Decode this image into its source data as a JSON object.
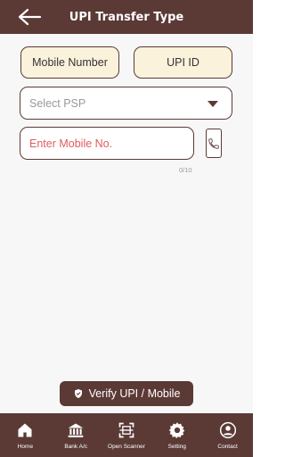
{
  "header": {
    "title": "UPI Transfer Type",
    "back_icon": "back-arrow-icon"
  },
  "transfer_type": {
    "mobile_label": "Mobile Number",
    "upi_label": "UPI ID"
  },
  "psp": {
    "placeholder": "Select PSP"
  },
  "mobile": {
    "placeholder": "Enter Mobile No.",
    "counter": "0/10"
  },
  "verify": {
    "label": "Verify UPI / Mobile"
  },
  "nav": {
    "items": [
      {
        "label": "Home",
        "icon": "home-icon"
      },
      {
        "label": "Bank A/c",
        "icon": "bank-icon"
      },
      {
        "label": "Open Scanner",
        "icon": "scanner-icon"
      },
      {
        "label": "Setting",
        "icon": "gear-icon"
      },
      {
        "label": "Contact",
        "icon": "contact-icon"
      }
    ]
  },
  "colors": {
    "brand": "#5b3a36",
    "toggle_bg": "#fbf2dc",
    "placeholder_red": "#e05c5c"
  }
}
